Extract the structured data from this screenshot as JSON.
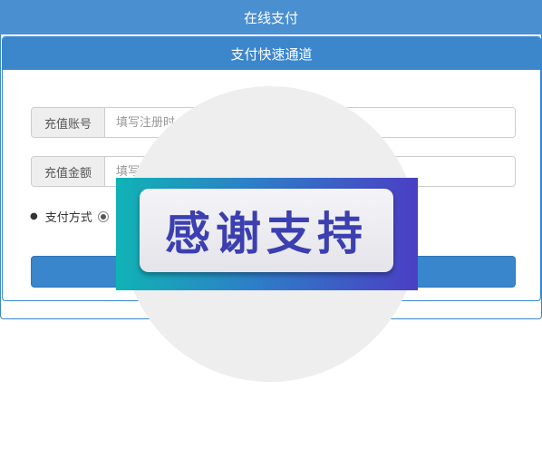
{
  "header": {
    "title": "在线支付"
  },
  "panel": {
    "title": "支付快速通道"
  },
  "form": {
    "account": {
      "label": "充值账号",
      "placeholder": "填写注册时"
    },
    "amount": {
      "label": "充值金额",
      "placeholder": "填写"
    },
    "payment": {
      "label": "支付方式"
    },
    "submit": {
      "label": ""
    }
  },
  "overlay": {
    "text": "感谢支持"
  },
  "colors": {
    "primary": "#4a8fd0",
    "panel_border": "#3a86cc",
    "overlay_text": "#3b3fb0"
  }
}
